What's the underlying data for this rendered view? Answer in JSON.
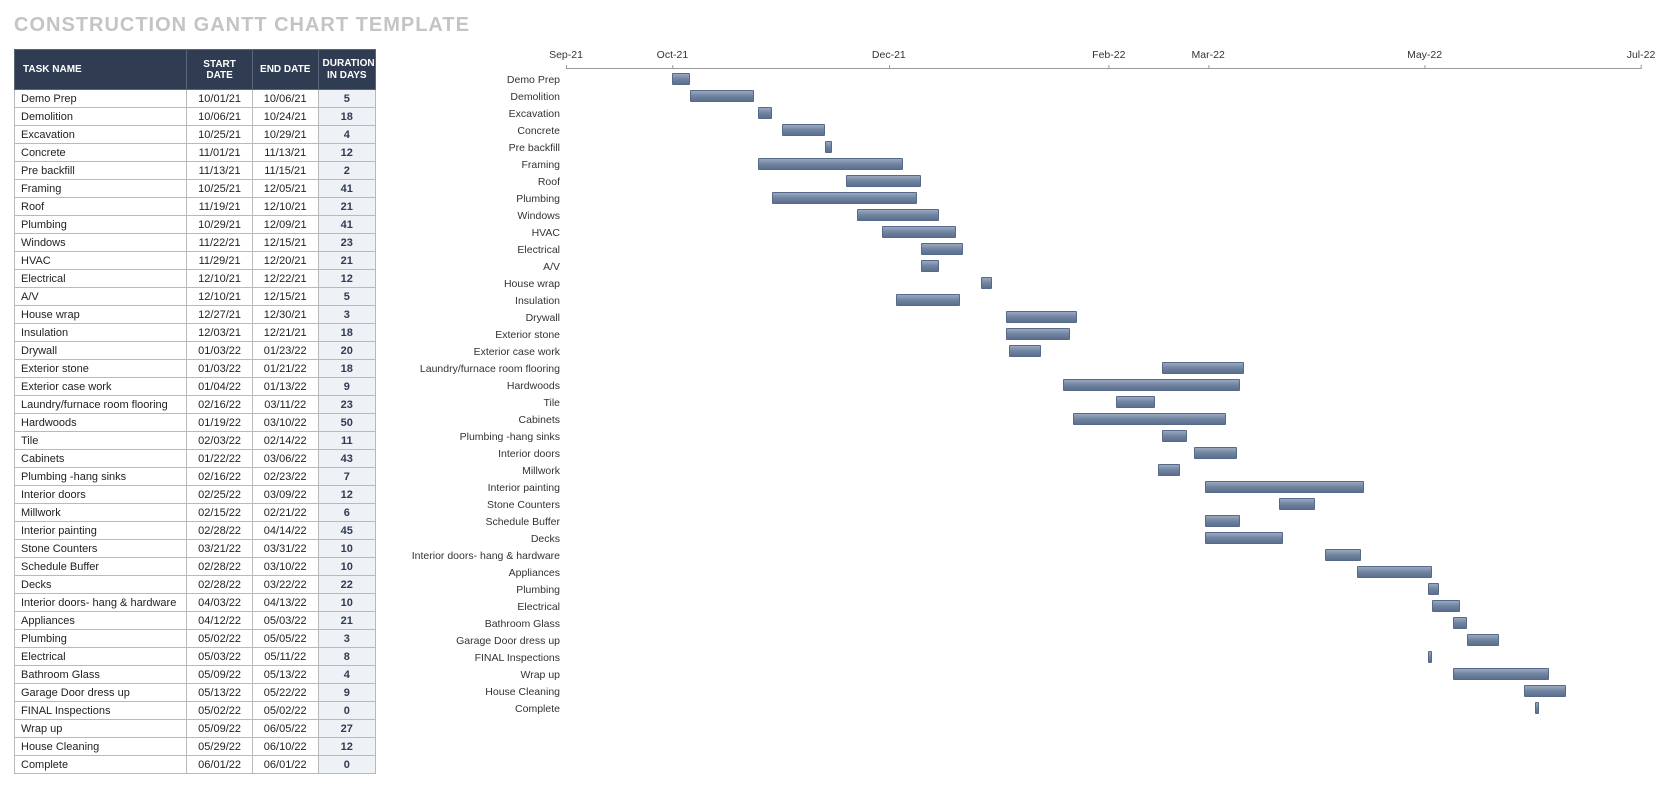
{
  "title": "CONSTRUCTION GANTT CHART TEMPLATE",
  "columns": {
    "name": "TASK NAME",
    "start": "START DATE",
    "end": "END DATE",
    "duration": "DURATION IN DAYS"
  },
  "tasks": [
    {
      "name": "Demo Prep",
      "start": "10/01/21",
      "end": "10/06/21",
      "duration": 5
    },
    {
      "name": "Demolition",
      "start": "10/06/21",
      "end": "10/24/21",
      "duration": 18
    },
    {
      "name": "Excavation",
      "start": "10/25/21",
      "end": "10/29/21",
      "duration": 4
    },
    {
      "name": "Concrete",
      "start": "11/01/21",
      "end": "11/13/21",
      "duration": 12
    },
    {
      "name": "Pre backfill",
      "start": "11/13/21",
      "end": "11/15/21",
      "duration": 2
    },
    {
      "name": "Framing",
      "start": "10/25/21",
      "end": "12/05/21",
      "duration": 41
    },
    {
      "name": "Roof",
      "start": "11/19/21",
      "end": "12/10/21",
      "duration": 21
    },
    {
      "name": "Plumbing",
      "start": "10/29/21",
      "end": "12/09/21",
      "duration": 41
    },
    {
      "name": "Windows",
      "start": "11/22/21",
      "end": "12/15/21",
      "duration": 23
    },
    {
      "name": "HVAC",
      "start": "11/29/21",
      "end": "12/20/21",
      "duration": 21
    },
    {
      "name": "Electrical",
      "start": "12/10/21",
      "end": "12/22/21",
      "duration": 12
    },
    {
      "name": "A/V",
      "start": "12/10/21",
      "end": "12/15/21",
      "duration": 5
    },
    {
      "name": "House wrap",
      "start": "12/27/21",
      "end": "12/30/21",
      "duration": 3
    },
    {
      "name": "Insulation",
      "start": "12/03/21",
      "end": "12/21/21",
      "duration": 18
    },
    {
      "name": "Drywall",
      "start": "01/03/22",
      "end": "01/23/22",
      "duration": 20
    },
    {
      "name": "Exterior stone",
      "start": "01/03/22",
      "end": "01/21/22",
      "duration": 18
    },
    {
      "name": "Exterior case work",
      "start": "01/04/22",
      "end": "01/13/22",
      "duration": 9
    },
    {
      "name": "Laundry/furnace room flooring",
      "start": "02/16/22",
      "end": "03/11/22",
      "duration": 23
    },
    {
      "name": "Hardwoods",
      "start": "01/19/22",
      "end": "03/10/22",
      "duration": 50
    },
    {
      "name": "Tile",
      "start": "02/03/22",
      "end": "02/14/22",
      "duration": 11
    },
    {
      "name": "Cabinets",
      "start": "01/22/22",
      "end": "03/06/22",
      "duration": 43
    },
    {
      "name": "Plumbing -hang sinks",
      "start": "02/16/22",
      "end": "02/23/22",
      "duration": 7
    },
    {
      "name": "Interior doors",
      "start": "02/25/22",
      "end": "03/09/22",
      "duration": 12
    },
    {
      "name": "Millwork",
      "start": "02/15/22",
      "end": "02/21/22",
      "duration": 6
    },
    {
      "name": "Interior painting",
      "start": "02/28/22",
      "end": "04/14/22",
      "duration": 45
    },
    {
      "name": "Stone Counters",
      "start": "03/21/22",
      "end": "03/31/22",
      "duration": 10
    },
    {
      "name": "Schedule Buffer",
      "start": "02/28/22",
      "end": "03/10/22",
      "duration": 10
    },
    {
      "name": "Decks",
      "start": "02/28/22",
      "end": "03/22/22",
      "duration": 22
    },
    {
      "name": "Interior doors- hang & hardware",
      "start": "04/03/22",
      "end": "04/13/22",
      "duration": 10
    },
    {
      "name": "Appliances",
      "start": "04/12/22",
      "end": "05/03/22",
      "duration": 21
    },
    {
      "name": "Plumbing",
      "start": "05/02/22",
      "end": "05/05/22",
      "duration": 3
    },
    {
      "name": "Electrical",
      "start": "05/03/22",
      "end": "05/11/22",
      "duration": 8
    },
    {
      "name": "Bathroom Glass",
      "start": "05/09/22",
      "end": "05/13/22",
      "duration": 4
    },
    {
      "name": "Garage Door dress up",
      "start": "05/13/22",
      "end": "05/22/22",
      "duration": 9
    },
    {
      "name": "FINAL Inspections",
      "start": "05/02/22",
      "end": "05/02/22",
      "duration": 0
    },
    {
      "name": "Wrap up",
      "start": "05/09/22",
      "end": "06/05/22",
      "duration": 27
    },
    {
      "name": "House Cleaning",
      "start": "05/29/22",
      "end": "06/10/22",
      "duration": 12
    },
    {
      "name": "Complete",
      "start": "06/01/22",
      "end": "06/01/22",
      "duration": 0
    }
  ],
  "chart_data": {
    "type": "bar",
    "title": "CONSTRUCTION GANTT CHART TEMPLATE",
    "xlabel": "",
    "ylabel": "",
    "x_axis_ticks": [
      "Sep-21",
      "Oct-21",
      "Dec-21",
      "Feb-22",
      "Mar-22",
      "May-22",
      "Jul-22"
    ],
    "x_range": [
      "2021-09-01",
      "2022-07-01"
    ],
    "categories": [
      "Demo Prep",
      "Demolition",
      "Excavation",
      "Concrete",
      "Pre backfill",
      "Framing",
      "Roof",
      "Plumbing",
      "Windows",
      "HVAC",
      "Electrical",
      "A/V",
      "House wrap",
      "Insulation",
      "Drywall",
      "Exterior stone",
      "Exterior case work",
      "Laundry/furnace room flooring",
      "Hardwoods",
      "Tile",
      "Cabinets",
      "Plumbing -hang sinks",
      "Interior doors",
      "Millwork",
      "Interior painting",
      "Stone Counters",
      "Schedule Buffer",
      "Decks",
      "Interior doors- hang & hardware",
      "Appliances",
      "Plumbing",
      "Electrical",
      "Bathroom Glass",
      "Garage Door dress up",
      "FINAL Inspections",
      "Wrap up",
      "House Cleaning",
      "Complete"
    ],
    "series": [
      {
        "name": "start_date",
        "values": [
          "2021-10-01",
          "2021-10-06",
          "2021-10-25",
          "2021-11-01",
          "2021-11-13",
          "2021-10-25",
          "2021-11-19",
          "2021-10-29",
          "2021-11-22",
          "2021-11-29",
          "2021-12-10",
          "2021-12-10",
          "2021-12-27",
          "2021-12-03",
          "2022-01-03",
          "2022-01-03",
          "2022-01-04",
          "2022-02-16",
          "2022-01-19",
          "2022-02-03",
          "2022-01-22",
          "2022-02-16",
          "2022-02-25",
          "2022-02-15",
          "2022-02-28",
          "2022-03-21",
          "2022-02-28",
          "2022-02-28",
          "2022-04-03",
          "2022-04-12",
          "2022-05-02",
          "2022-05-03",
          "2022-05-09",
          "2022-05-13",
          "2022-05-02",
          "2022-05-09",
          "2022-05-29",
          "2022-06-01"
        ]
      },
      {
        "name": "duration_days",
        "values": [
          5,
          18,
          4,
          12,
          2,
          41,
          21,
          41,
          23,
          21,
          12,
          5,
          3,
          18,
          20,
          18,
          9,
          23,
          50,
          11,
          43,
          7,
          12,
          6,
          45,
          10,
          10,
          22,
          10,
          21,
          3,
          8,
          4,
          9,
          0,
          27,
          12,
          0
        ]
      }
    ]
  }
}
